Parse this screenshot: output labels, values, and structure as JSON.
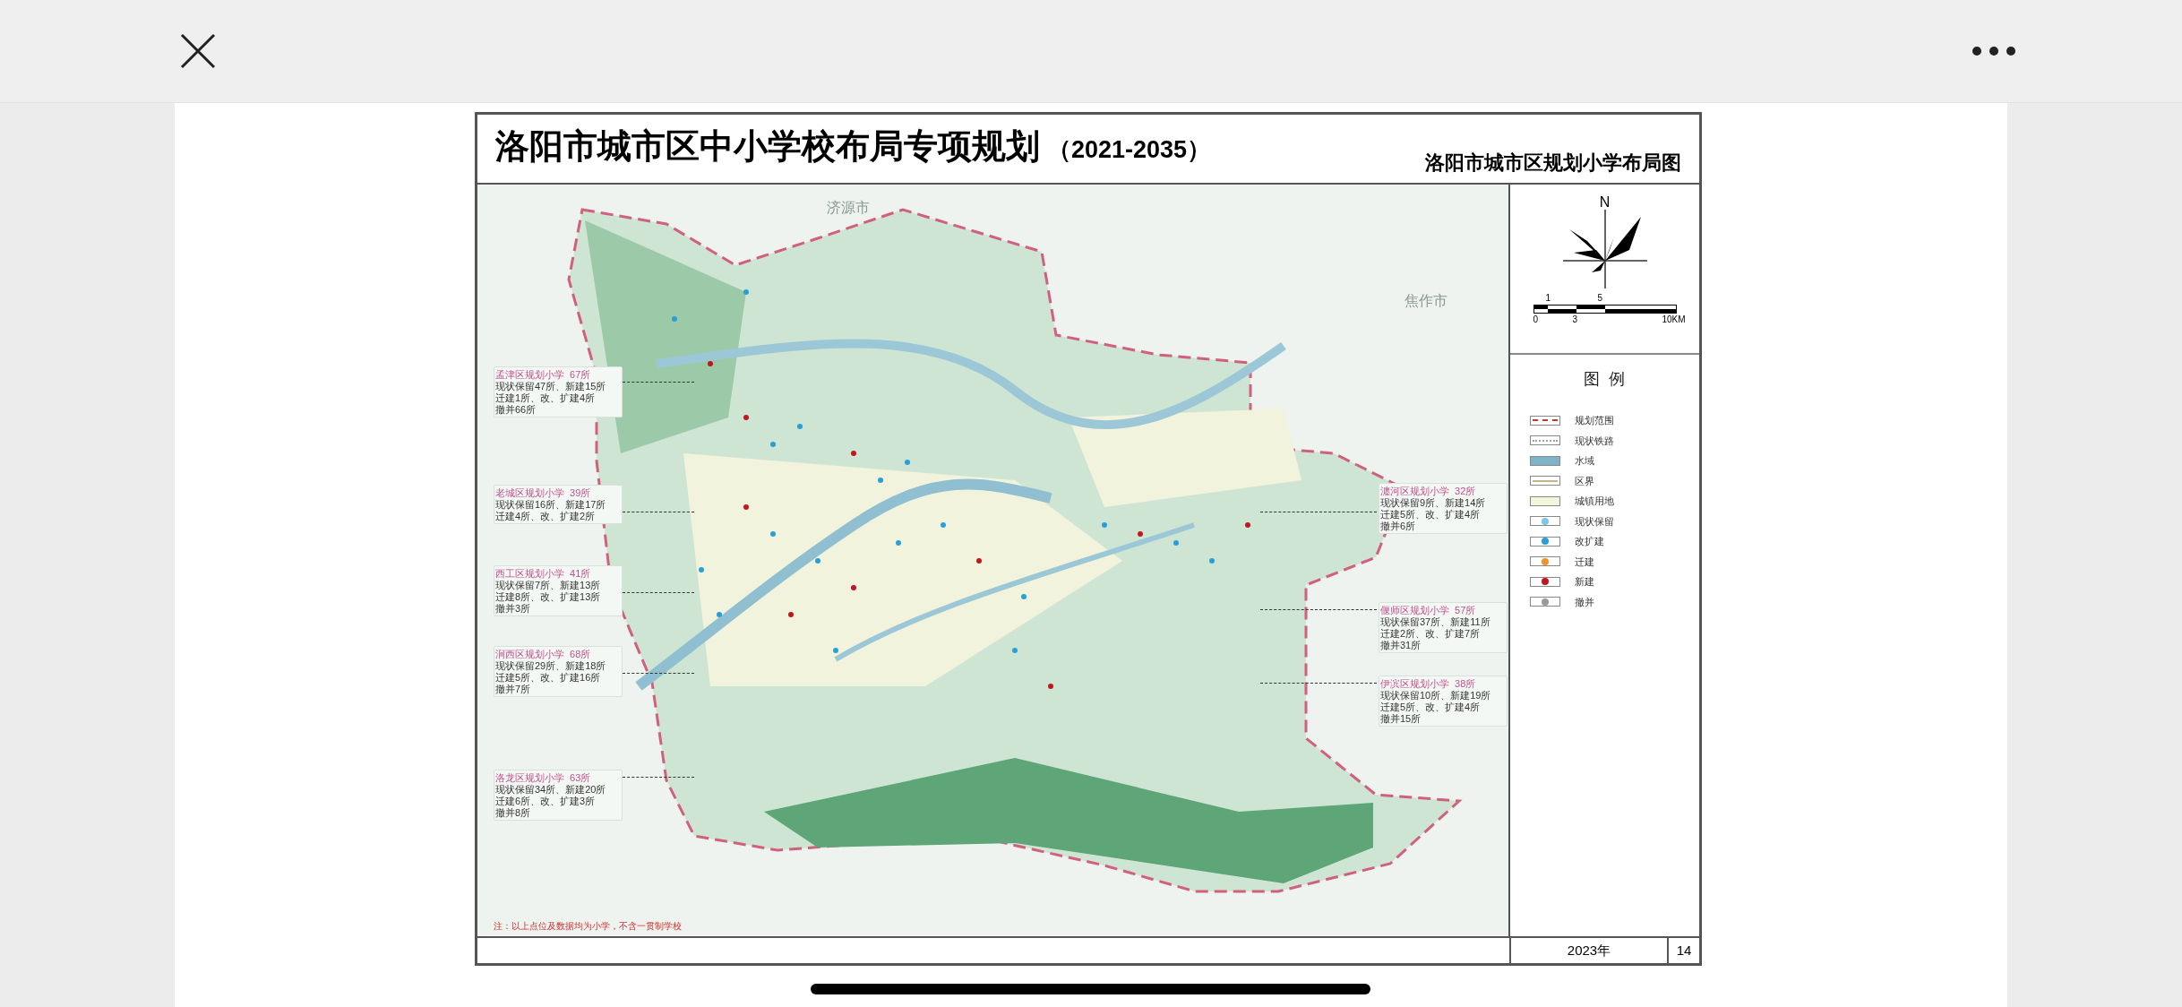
{
  "document": {
    "title": "洛阳市城市区中小学校布局专项规划",
    "title_years": "（2021-2035）",
    "subtitle": "洛阳市城市区规划小学布局图",
    "map": {
      "place_labels": [
        "济源市",
        "焦作市"
      ],
      "districts": [
        {
          "heading": "孟津区规划小学  67所",
          "lines": [
            "现状保留47所、新建15所",
            "迁建1所、改、扩建4所",
            "撤并66所"
          ]
        },
        {
          "heading": "老城区规划小学  39所",
          "lines": [
            "现状保留16所、新建17所",
            "迁建4所、改、扩建2所"
          ]
        },
        {
          "heading": "西工区规划小学  41所",
          "lines": [
            "现状保留7所、新建13所",
            "迁建8所、改、扩建13所",
            "撤并3所"
          ]
        },
        {
          "heading": "涧西区规划小学  68所",
          "lines": [
            "现状保留29所、新建18所",
            "迁建5所、改、扩建16所",
            "撤并7所"
          ]
        },
        {
          "heading": "洛龙区规划小学  63所",
          "lines": [
            "现状保留34所、新建20所",
            "迁建6所、改、扩建3所",
            "撤并8所"
          ]
        },
        {
          "heading": "瀍河区规划小学  32所",
          "lines": [
            "现状保留9所、新建14所",
            "迁建5所、改、扩建4所",
            "撤并6所"
          ]
        },
        {
          "heading": "偃师区规划小学  57所",
          "lines": [
            "现状保留37所、新建11所",
            "迁建2所、改、扩建7所",
            "撤并31所"
          ]
        },
        {
          "heading": "伊滨区规划小学  38所",
          "lines": [
            "现状保留10所、新建19所",
            "迁建5所、改、扩建4所",
            "撤并15所"
          ]
        }
      ],
      "note": "注：以上点位及数据均为小学，不含一贯制学校"
    },
    "compass": {
      "north": "N"
    },
    "scale": {
      "top_labels": [
        "1",
        "5"
      ],
      "bottom_labels": [
        "0",
        "3",
        "10KM"
      ]
    },
    "legend": {
      "title": "图  例",
      "items": [
        {
          "kind": "dashed",
          "color": "#c0392b",
          "label": "规划范围"
        },
        {
          "kind": "dotted",
          "color": "#9aa5b1",
          "label": "现状铁路"
        },
        {
          "kind": "fill",
          "color": "#7fb3c8",
          "label": "水域"
        },
        {
          "kind": "line",
          "color": "#c9b48a",
          "label": "区界"
        },
        {
          "kind": "fill",
          "color": "#f3f5dc",
          "label": "城镇用地"
        },
        {
          "kind": "dot",
          "color": "#7cc6e8",
          "label": "现状保留"
        },
        {
          "kind": "dot",
          "color": "#2a9fd6",
          "label": "改扩建"
        },
        {
          "kind": "dot",
          "color": "#f0932b",
          "label": "迁建"
        },
        {
          "kind": "dot",
          "color": "#c0171d",
          "label": "新建"
        },
        {
          "kind": "dot",
          "color": "#9a9a9a",
          "label": "撤并"
        }
      ]
    },
    "footer": {
      "year": "2023年",
      "page": "14"
    }
  }
}
